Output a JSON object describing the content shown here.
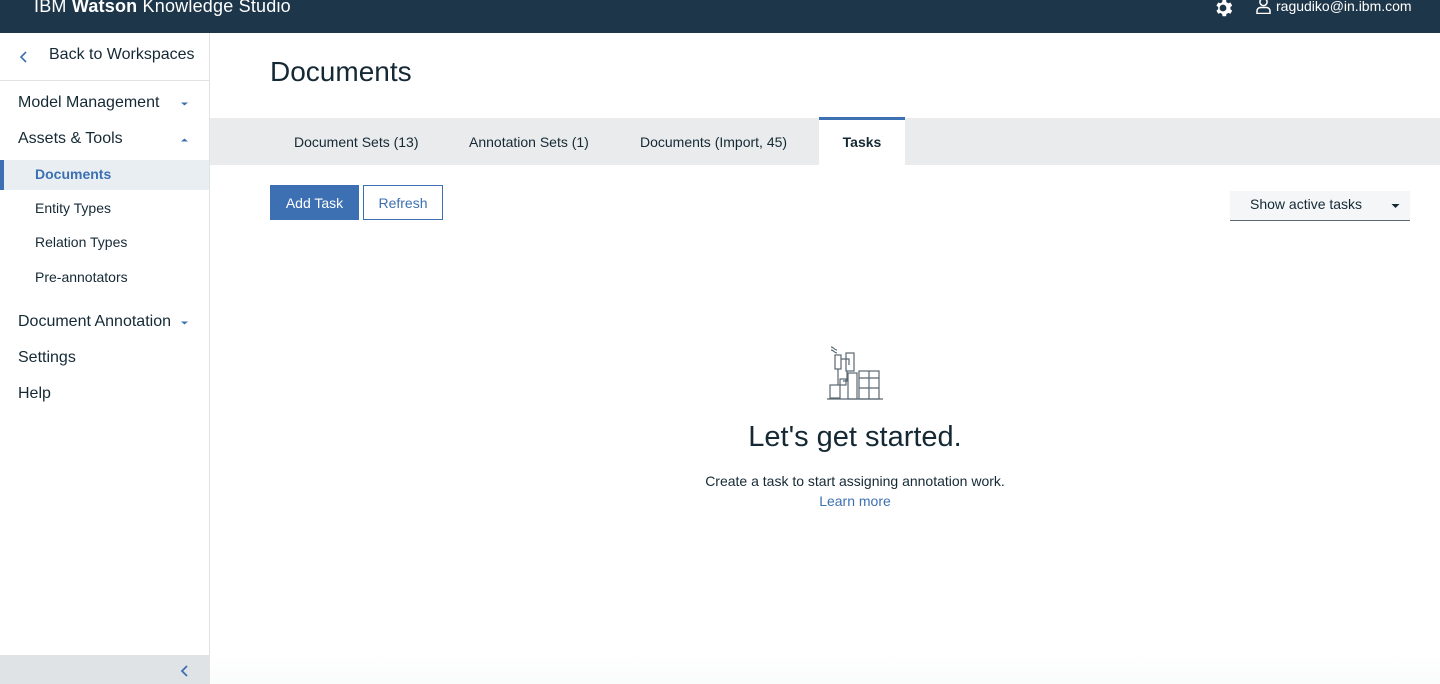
{
  "header": {
    "brand_prefix": "IBM",
    "brand_bold": "Watson",
    "brand_suffix": "Knowledge Studio",
    "user_email": "ragudiko@in.ibm.com",
    "icons": [
      "gear-icon",
      "user-icon"
    ],
    "bg_color": "#1d3649"
  },
  "sidebar": {
    "back_label": "Back to Workspaces",
    "sections": [
      {
        "label": "Model Management",
        "expanded": false
      },
      {
        "label": "Assets & Tools",
        "expanded": true
      },
      {
        "label": "Document Annotation",
        "expanded": false
      }
    ],
    "assets_items": [
      {
        "label": "Documents",
        "active": true
      },
      {
        "label": "Entity Types",
        "active": false
      },
      {
        "label": "Relation Types",
        "active": false
      },
      {
        "label": "Pre-annotators",
        "active": false
      }
    ],
    "settings_label": "Settings",
    "help_label": "Help"
  },
  "main": {
    "title": "Documents",
    "tabs": [
      {
        "label": "Document Sets (13)",
        "selected": false
      },
      {
        "label": "Annotation Sets (1)",
        "selected": false
      },
      {
        "label": "Documents (Import, 45)",
        "selected": false
      },
      {
        "label": "Tasks",
        "selected": true
      }
    ],
    "add_task_label": "Add Task",
    "refresh_label": "Refresh",
    "filter_value": "Show active tasks",
    "empty_title": "Let's get started.",
    "empty_text": "Create a task to start assigning annotation work.",
    "learn_more": "Learn more"
  },
  "colors": {
    "accent": "#3d70b2",
    "text": "#152935",
    "tab_bar": "#e9ebec"
  }
}
